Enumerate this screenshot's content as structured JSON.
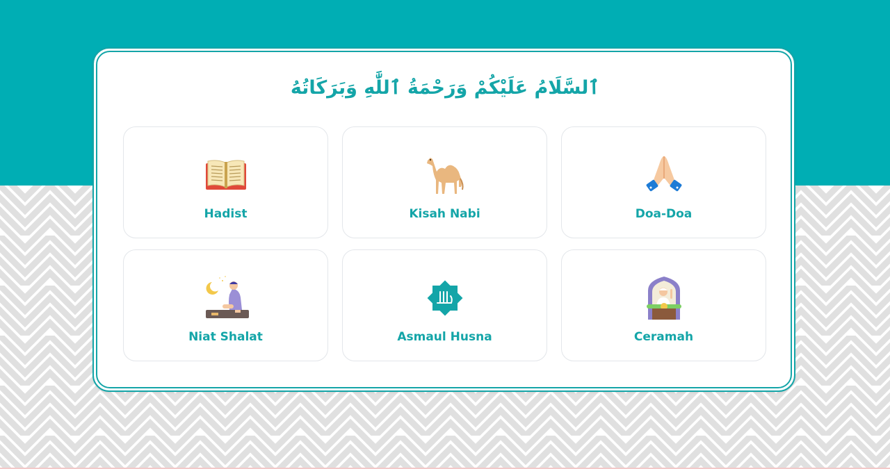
{
  "header": {
    "greeting": "ٱلسَّلَامُ عَلَيْكُمْ وَرَحْمَةُ ٱللَّٰهِ وَبَرَكَاتُهُ"
  },
  "colors": {
    "accent": "#00aeb4",
    "accent_text": "#14a5a8",
    "card_border": "#e3e6ea",
    "pattern": "#e0e0e0"
  },
  "menu": {
    "items": [
      {
        "label": "Hadist",
        "icon": "open-book-icon"
      },
      {
        "label": "Kisah Nabi",
        "icon": "camel-icon"
      },
      {
        "label": "Doa-Doa",
        "icon": "praying-hands-icon"
      },
      {
        "label": "Niat Shalat",
        "icon": "praying-man-icon"
      },
      {
        "label": "Asmaul Husna",
        "icon": "allah-star-icon"
      },
      {
        "label": "Ceramah",
        "icon": "preacher-icon"
      }
    ]
  }
}
